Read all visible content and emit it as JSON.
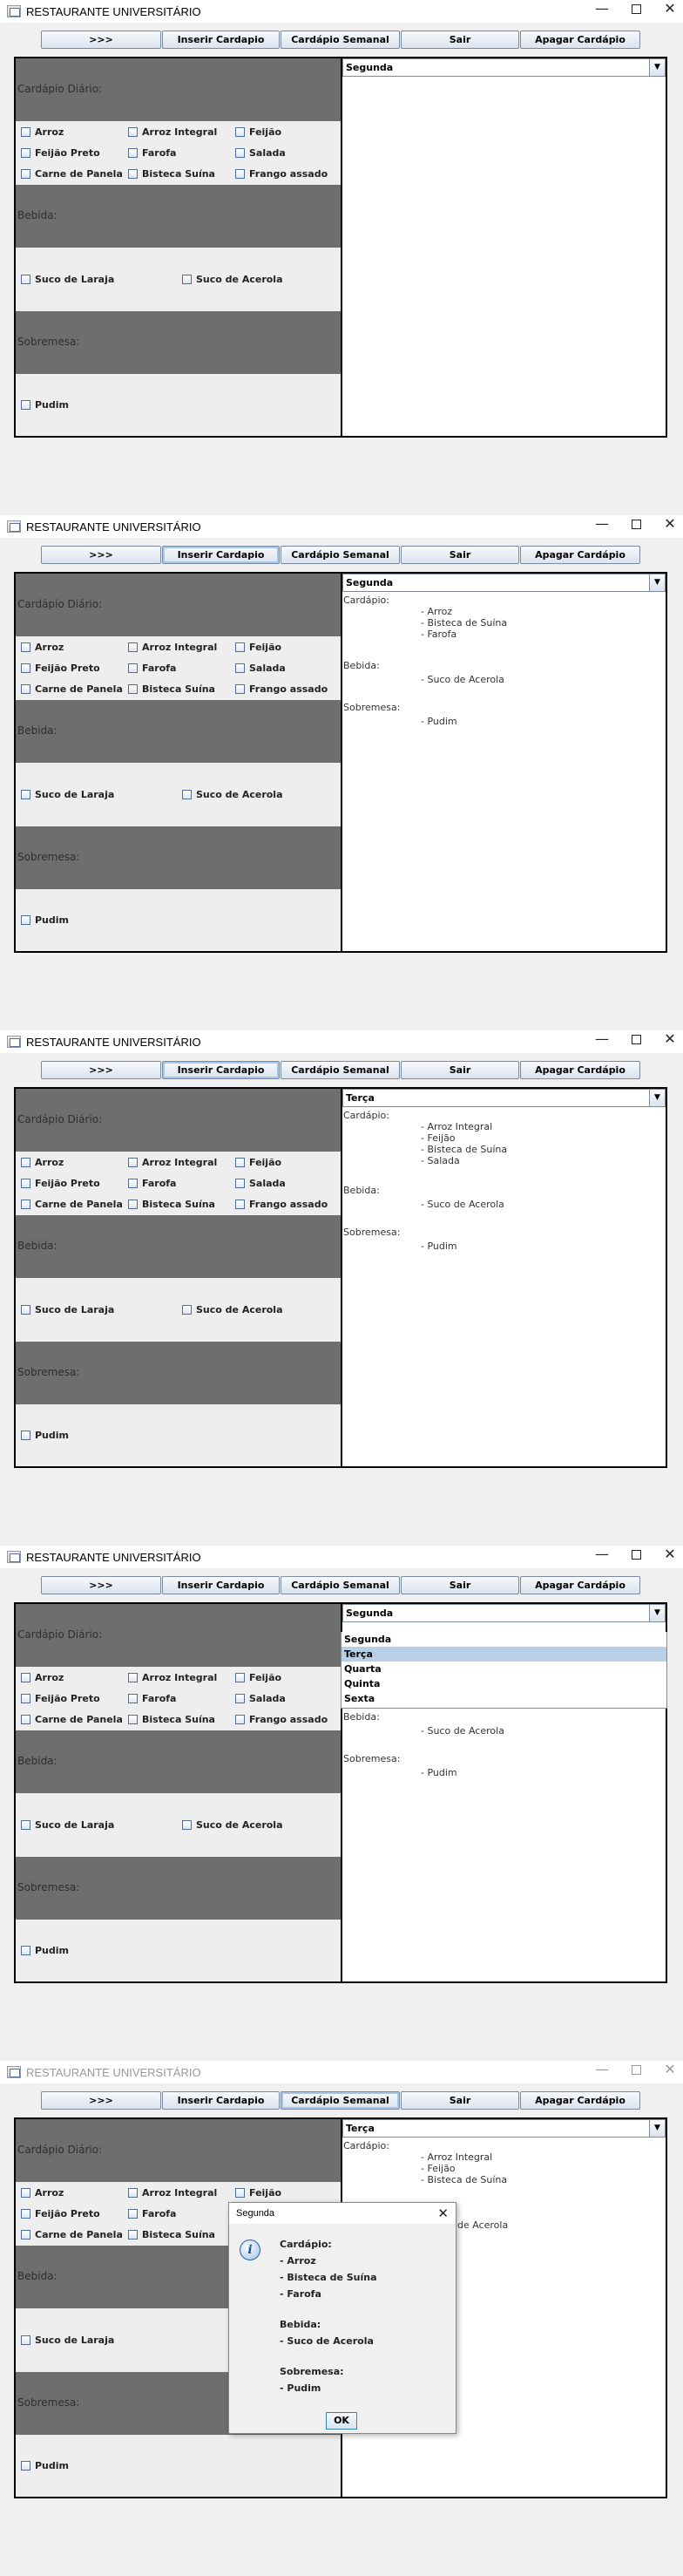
{
  "app_title": "RESTAURANTE UNIVERSITÁRIO",
  "window_controls": {
    "minimize": "—",
    "close": "✕"
  },
  "toolbar": {
    "next_label": ">>>",
    "insert_label": "Inserir Cardapio",
    "weekly_label": "Cardápio Semanal",
    "exit_label": "Sair",
    "delete_label": "Apagar Cardápio"
  },
  "sections": {
    "daily": "Cardápio Diário:",
    "drink": "Bebida:",
    "dessert": "Sobremesa:"
  },
  "foods": [
    "Arroz",
    "Arroz Integral",
    "Feijão",
    "Feijão Preto",
    "Farofa",
    "Salada",
    "Carne de  Panela",
    "Bisteca Suína",
    "Frango assado"
  ],
  "drinks": [
    "Suco de Laraja",
    "Suco de Acerola"
  ],
  "desserts": [
    "Pudim"
  ],
  "days": [
    "Segunda",
    "Terça",
    "Quarta",
    "Quinta",
    "Sexta"
  ],
  "combo_arrow": "▼",
  "frames": [
    {
      "selected_day": "Segunda",
      "menu_text": []
    },
    {
      "selected_day": "Segunda",
      "menu_text": [
        "Cardápio:",
        "- Arroz",
        "- Bisteca de Suína",
        "- Farofa",
        "Bebida:",
        "- Suco de Acerola",
        "Sobremesa:",
        "- Pudim"
      ]
    },
    {
      "selected_day": "Terça",
      "menu_text": [
        "Cardápio:",
        "- Arroz Integral",
        "- Feijão",
        "- Bisteca de Suína",
        "- Salada",
        "Bebida:",
        "- Suco de Acerola",
        "Sobremesa:",
        "- Pudim"
      ]
    },
    {
      "selected_day": "Segunda",
      "dropdown_highlight": "Terça",
      "menu_text": [
        "Bebida:",
        "- Suco de Acerola",
        "Sobremesa:",
        "- Pudim"
      ]
    },
    {
      "selected_day": "Terça",
      "menu_text": [
        "Cardápio:",
        "- Arroz Integral",
        "- Feijão",
        "- Bisteca de Suína",
        "de Acerola"
      ]
    }
  ],
  "dialog": {
    "title": "Segunda",
    "icon": "i",
    "lines": [
      "Cardápio:",
      "- Arroz",
      "- Bisteca de Suína",
      "- Farofa",
      "Bebida:",
      "- Suco de Acerola",
      "Sobremesa:",
      "- Pudim"
    ],
    "ok_label": "OK"
  },
  "colors": {
    "section_band": "#6e6e6e",
    "panel_bg": "#eeeeee",
    "window_bg": "#f0f0f0",
    "highlight": "#b8cfe8"
  }
}
